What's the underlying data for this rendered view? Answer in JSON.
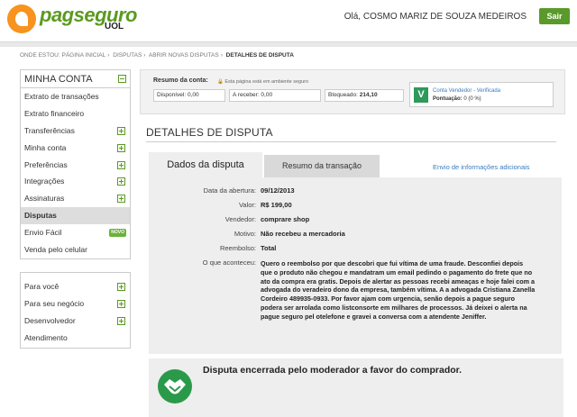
{
  "header": {
    "brand": "pagseguro",
    "brand_sub": "UOL",
    "greeting": "Olá, COSMO MARIZ DE SOUZA MEDEIROS",
    "logout_label": "Sair"
  },
  "breadcrumb": {
    "prefix": "ONDE ESTOU:",
    "items": [
      "PÁGINA INICIAL",
      "DISPUTAS",
      "ABRIR NOVAS DISPUTAS"
    ],
    "current": "DETALHES DE DISPUTA"
  },
  "sidebar": {
    "title": "MINHA CONTA",
    "items": [
      {
        "label": "Extrato de transações"
      },
      {
        "label": "Extrato financeiro"
      },
      {
        "label": "Transferências"
      },
      {
        "label": "Minha conta"
      },
      {
        "label": "Preferências"
      },
      {
        "label": "Integrações"
      },
      {
        "label": "Assinaturas"
      },
      {
        "label": "Disputas"
      },
      {
        "label": "Envio Fácil",
        "badge": "NOVO"
      },
      {
        "label": "Venda pelo celular"
      }
    ],
    "items2": [
      {
        "label": "Para você"
      },
      {
        "label": "Para seu negócio"
      },
      {
        "label": "Desenvolvedor"
      },
      {
        "label": "Atendimento"
      }
    ]
  },
  "account": {
    "summary_label": "Resumo da conta:",
    "env_note": "Esta página está em ambiente seguro",
    "available": "Disponível: 0,00",
    "receivable": "A receber: 0,00",
    "blocked_label": "Bloqueado: ",
    "blocked_value": "214,10",
    "verified_letter": "V",
    "verified_label": "Conta Vendedor - Verificada",
    "points_label": "Pontuação: ",
    "points_value": "0 (0 %)"
  },
  "page_title": "DETALHES DE DISPUTA",
  "tabs": {
    "active": "Dados da disputa",
    "other": "Resumo da transação",
    "extra_link": "Envio de informações adicionais"
  },
  "details": {
    "opened_label": "Data da abertura:",
    "opened": "09/12/2013",
    "value_label": "Valor:",
    "value": "R$ 199,00",
    "seller_label": "Vendedor:",
    "seller": "comprare shop",
    "reason_label": "Motivo:",
    "reason": "Não recebeu a mercadoria",
    "refund_label": "Reembolso:",
    "refund": "Total",
    "what_label": "O que aconteceu:",
    "what": "Quero o reembolso por que descobri que fui vítima de uma fraude. Desconfiei depois que o produto não chegou e mandatram um email pedindo o pagamento do frete que no ato da compra era gratis. Depois de alertar as pessoas recebi ameaças e hoje falei com a advogada do veradeiro dono da empresa, também vítima. A a advogada Cristiana Zanella Cordeiro 489935-0933. Por favor ajam com urgencia, senão depois a pague seguro podera ser arrolada como listconsorte em milhares de processos. Já deixei o alerta na pague seguro pel otelefone e gravei a conversa com a atendente Jeniffer."
  },
  "result": {
    "text": "Disputa encerrada pelo moderador a favor do comprador."
  }
}
